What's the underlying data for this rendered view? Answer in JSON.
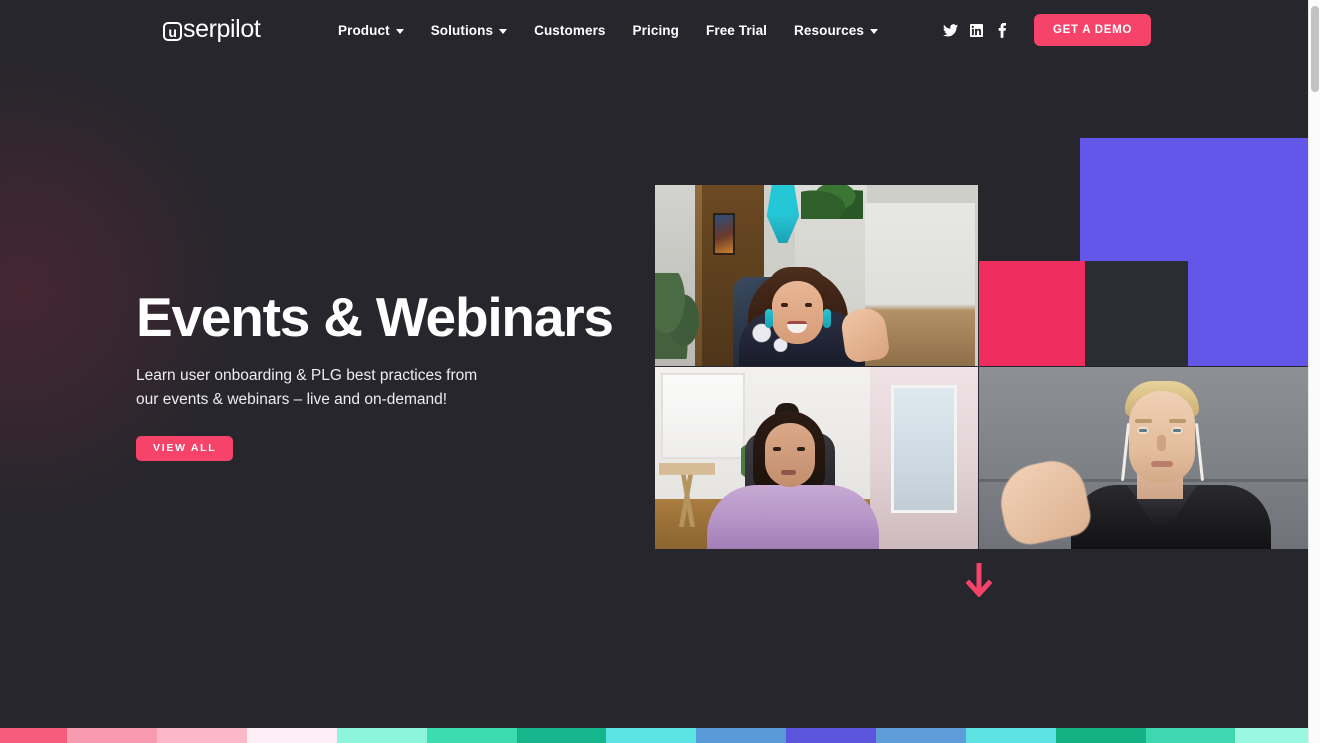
{
  "header": {
    "logo": {
      "mark": "u",
      "word": "serpilot",
      "full": "userpilot"
    },
    "nav": [
      {
        "label": "Product",
        "has_dropdown": true,
        "icon": "chevron-down-icon"
      },
      {
        "label": "Solutions",
        "has_dropdown": true,
        "icon": "chevron-down-icon"
      },
      {
        "label": "Customers",
        "has_dropdown": false,
        "icon": ""
      },
      {
        "label": "Pricing",
        "has_dropdown": false,
        "icon": ""
      },
      {
        "label": "Free Trial",
        "has_dropdown": false,
        "icon": ""
      },
      {
        "label": "Resources",
        "has_dropdown": true,
        "icon": "chevron-down-icon"
      }
    ],
    "social": [
      {
        "name": "twitter-icon",
        "label": "Twitter"
      },
      {
        "name": "linkedin-icon",
        "label": "LinkedIn"
      },
      {
        "name": "facebook-icon",
        "label": "Facebook"
      }
    ],
    "cta": {
      "label": "GET A DEMO",
      "color": "#f64369"
    }
  },
  "hero": {
    "title": "Events & Webinars",
    "subtitle_line1": "Learn user onboarding & PLG best practices from",
    "subtitle_line2": "our events & webinars – live and on-demand!",
    "cta": {
      "label": "VIEW ALL",
      "color": "#f64369"
    }
  },
  "collage": {
    "blocks": [
      {
        "name": "purple-block",
        "color": "#6257e8"
      },
      {
        "name": "pink-block",
        "color": "#ef2d5e"
      },
      {
        "name": "dark-notch",
        "color": "#2c2c33"
      }
    ],
    "photos": [
      {
        "name": "webinar-speaker-photo-top",
        "alt": "Woman with long dark hair speaking on a video call in a home office"
      },
      {
        "name": "webinar-speaker-photo-bottom-left",
        "alt": "Woman in a lilac sweater on a video call near a window"
      },
      {
        "name": "webinar-speaker-photo-bottom-right",
        "alt": "Person with blonde hair wearing earphones on a video call"
      }
    ]
  },
  "scroll_arrow": {
    "name": "scroll-down-arrow",
    "color": "#f64369"
  },
  "color_strip": [
    {
      "color": "#f65a7d",
      "width": 78
    },
    {
      "color": "#f89bb0",
      "width": 104
    },
    {
      "color": "#fbb9c7",
      "width": 104
    },
    {
      "color": "#fdeef6",
      "width": 104
    },
    {
      "color": "#8cf5dc",
      "width": 104
    },
    {
      "color": "#3ddcb0",
      "width": 104
    },
    {
      "color": "#16b68c",
      "width": 104
    },
    {
      "color": "#5ce3e3",
      "width": 104
    },
    {
      "color": "#589ada",
      "width": 104
    },
    {
      "color": "#5b55dd",
      "width": 104
    },
    {
      "color": "#5e9dda",
      "width": 104
    },
    {
      "color": "#5de1e1",
      "width": 104
    },
    {
      "color": "#14b184",
      "width": 104
    },
    {
      "color": "#3ed7b0",
      "width": 104
    },
    {
      "color": "#97f7e0",
      "width": 84
    }
  ],
  "theme": {
    "background": "#26262c",
    "text": "#ffffff",
    "accent_pink": "#f64369",
    "accent_purple": "#6257e8",
    "accent_magenta": "#ef2d5e"
  },
  "scrollbar": {
    "name": "page-scrollbar",
    "position": "top"
  }
}
